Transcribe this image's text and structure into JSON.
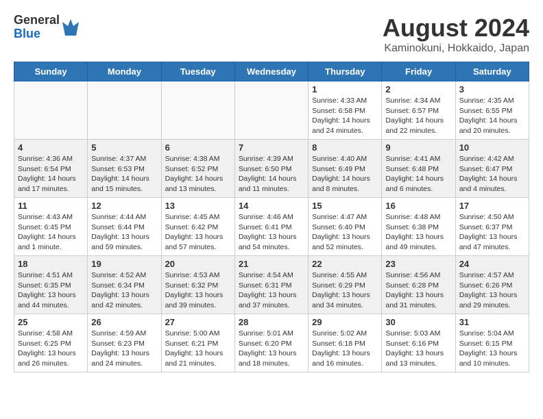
{
  "header": {
    "logo_general": "General",
    "logo_blue": "Blue",
    "month_year": "August 2024",
    "location": "Kaminokuni, Hokkaido, Japan"
  },
  "weekdays": [
    "Sunday",
    "Monday",
    "Tuesday",
    "Wednesday",
    "Thursday",
    "Friday",
    "Saturday"
  ],
  "weeks": [
    [
      {
        "day": "",
        "info": ""
      },
      {
        "day": "",
        "info": ""
      },
      {
        "day": "",
        "info": ""
      },
      {
        "day": "",
        "info": ""
      },
      {
        "day": "1",
        "info": "Sunrise: 4:33 AM\nSunset: 6:58 PM\nDaylight: 14 hours\nand 24 minutes."
      },
      {
        "day": "2",
        "info": "Sunrise: 4:34 AM\nSunset: 6:57 PM\nDaylight: 14 hours\nand 22 minutes."
      },
      {
        "day": "3",
        "info": "Sunrise: 4:35 AM\nSunset: 6:55 PM\nDaylight: 14 hours\nand 20 minutes."
      }
    ],
    [
      {
        "day": "4",
        "info": "Sunrise: 4:36 AM\nSunset: 6:54 PM\nDaylight: 14 hours\nand 17 minutes."
      },
      {
        "day": "5",
        "info": "Sunrise: 4:37 AM\nSunset: 6:53 PM\nDaylight: 14 hours\nand 15 minutes."
      },
      {
        "day": "6",
        "info": "Sunrise: 4:38 AM\nSunset: 6:52 PM\nDaylight: 14 hours\nand 13 minutes."
      },
      {
        "day": "7",
        "info": "Sunrise: 4:39 AM\nSunset: 6:50 PM\nDaylight: 14 hours\nand 11 minutes."
      },
      {
        "day": "8",
        "info": "Sunrise: 4:40 AM\nSunset: 6:49 PM\nDaylight: 14 hours\nand 8 minutes."
      },
      {
        "day": "9",
        "info": "Sunrise: 4:41 AM\nSunset: 6:48 PM\nDaylight: 14 hours\nand 6 minutes."
      },
      {
        "day": "10",
        "info": "Sunrise: 4:42 AM\nSunset: 6:47 PM\nDaylight: 14 hours\nand 4 minutes."
      }
    ],
    [
      {
        "day": "11",
        "info": "Sunrise: 4:43 AM\nSunset: 6:45 PM\nDaylight: 14 hours\nand 1 minute."
      },
      {
        "day": "12",
        "info": "Sunrise: 4:44 AM\nSunset: 6:44 PM\nDaylight: 13 hours\nand 59 minutes."
      },
      {
        "day": "13",
        "info": "Sunrise: 4:45 AM\nSunset: 6:42 PM\nDaylight: 13 hours\nand 57 minutes."
      },
      {
        "day": "14",
        "info": "Sunrise: 4:46 AM\nSunset: 6:41 PM\nDaylight: 13 hours\nand 54 minutes."
      },
      {
        "day": "15",
        "info": "Sunrise: 4:47 AM\nSunset: 6:40 PM\nDaylight: 13 hours\nand 52 minutes."
      },
      {
        "day": "16",
        "info": "Sunrise: 4:48 AM\nSunset: 6:38 PM\nDaylight: 13 hours\nand 49 minutes."
      },
      {
        "day": "17",
        "info": "Sunrise: 4:50 AM\nSunset: 6:37 PM\nDaylight: 13 hours\nand 47 minutes."
      }
    ],
    [
      {
        "day": "18",
        "info": "Sunrise: 4:51 AM\nSunset: 6:35 PM\nDaylight: 13 hours\nand 44 minutes."
      },
      {
        "day": "19",
        "info": "Sunrise: 4:52 AM\nSunset: 6:34 PM\nDaylight: 13 hours\nand 42 minutes."
      },
      {
        "day": "20",
        "info": "Sunrise: 4:53 AM\nSunset: 6:32 PM\nDaylight: 13 hours\nand 39 minutes."
      },
      {
        "day": "21",
        "info": "Sunrise: 4:54 AM\nSunset: 6:31 PM\nDaylight: 13 hours\nand 37 minutes."
      },
      {
        "day": "22",
        "info": "Sunrise: 4:55 AM\nSunset: 6:29 PM\nDaylight: 13 hours\nand 34 minutes."
      },
      {
        "day": "23",
        "info": "Sunrise: 4:56 AM\nSunset: 6:28 PM\nDaylight: 13 hours\nand 31 minutes."
      },
      {
        "day": "24",
        "info": "Sunrise: 4:57 AM\nSunset: 6:26 PM\nDaylight: 13 hours\nand 29 minutes."
      }
    ],
    [
      {
        "day": "25",
        "info": "Sunrise: 4:58 AM\nSunset: 6:25 PM\nDaylight: 13 hours\nand 26 minutes."
      },
      {
        "day": "26",
        "info": "Sunrise: 4:59 AM\nSunset: 6:23 PM\nDaylight: 13 hours\nand 24 minutes."
      },
      {
        "day": "27",
        "info": "Sunrise: 5:00 AM\nSunset: 6:21 PM\nDaylight: 13 hours\nand 21 minutes."
      },
      {
        "day": "28",
        "info": "Sunrise: 5:01 AM\nSunset: 6:20 PM\nDaylight: 13 hours\nand 18 minutes."
      },
      {
        "day": "29",
        "info": "Sunrise: 5:02 AM\nSunset: 6:18 PM\nDaylight: 13 hours\nand 16 minutes."
      },
      {
        "day": "30",
        "info": "Sunrise: 5:03 AM\nSunset: 6:16 PM\nDaylight: 13 hours\nand 13 minutes."
      },
      {
        "day": "31",
        "info": "Sunrise: 5:04 AM\nSunset: 6:15 PM\nDaylight: 13 hours\nand 10 minutes."
      }
    ]
  ]
}
